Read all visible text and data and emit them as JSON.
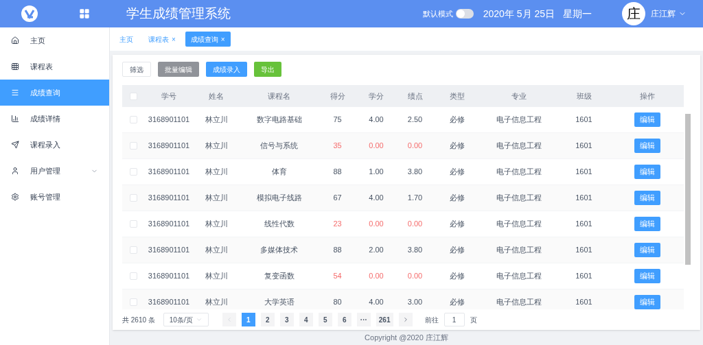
{
  "header": {
    "title": "学生成绩管理系统",
    "mode_label": "默认模式",
    "mode_switch": {
      "on": false
    },
    "date": "2020年 5月 25日",
    "weekday": "星期一",
    "avatar": "庄",
    "user": "庄江辉"
  },
  "sidebar": {
    "items": [
      {
        "label": "主页",
        "selected": false,
        "kind": "link"
      },
      {
        "label": "课程表",
        "selected": false,
        "kind": "link"
      },
      {
        "label": "成绩查询",
        "selected": true,
        "kind": "link"
      },
      {
        "label": "成绩详情",
        "selected": false,
        "kind": "link"
      },
      {
        "label": "课程录入",
        "selected": false,
        "kind": "link"
      },
      {
        "label": "用户管理",
        "selected": false,
        "kind": "group"
      },
      {
        "label": "账号管理",
        "selected": false,
        "kind": "link"
      }
    ]
  },
  "tabs": [
    {
      "label": "主页",
      "selected": false
    },
    {
      "label": "课程表",
      "selected": false,
      "close": "×"
    },
    {
      "label": "成绩查询",
      "selected": true,
      "close": "×"
    }
  ],
  "toolbar": [
    {
      "label": "筛选",
      "kind": "plain"
    },
    {
      "label": "批量编辑",
      "kind": "gray"
    },
    {
      "label": "成绩录入",
      "kind": "primary"
    },
    {
      "label": "导出",
      "kind": "success"
    }
  ],
  "table": {
    "columns": [
      "学号",
      "姓名",
      "课程名",
      "得分",
      "学分",
      "绩点",
      "类型",
      "专业",
      "班级",
      "操作"
    ],
    "header_checkbox": {
      "checked": false
    },
    "rows": [
      {
        "checked": false,
        "failed": false,
        "cells": [
          "3168901101",
          "林立川",
          "数字电路基础",
          "75",
          "4.00",
          "2.50",
          "必修",
          "电子信息工程",
          "1601"
        ],
        "action": "编辑"
      },
      {
        "checked": false,
        "failed": true,
        "cells": [
          "3168901101",
          "林立川",
          "信号与系统",
          "35",
          "0.00",
          "0.00",
          "必修",
          "电子信息工程",
          "1601"
        ],
        "action": "编辑"
      },
      {
        "checked": false,
        "failed": false,
        "cells": [
          "3168901101",
          "林立川",
          "体育",
          "88",
          "1.00",
          "3.80",
          "必修",
          "电子信息工程",
          "1601"
        ],
        "action": "编辑"
      },
      {
        "checked": false,
        "failed": false,
        "cells": [
          "3168901101",
          "林立川",
          "模拟电子线路",
          "67",
          "4.00",
          "1.70",
          "必修",
          "电子信息工程",
          "1601"
        ],
        "action": "编辑"
      },
      {
        "checked": false,
        "failed": true,
        "cells": [
          "3168901101",
          "林立川",
          "线性代数",
          "23",
          "0.00",
          "0.00",
          "必修",
          "电子信息工程",
          "1601"
        ],
        "action": "编辑"
      },
      {
        "checked": false,
        "failed": false,
        "cells": [
          "3168901101",
          "林立川",
          "多媒体技术",
          "88",
          "2.00",
          "3.80",
          "必修",
          "电子信息工程",
          "1601"
        ],
        "action": "编辑"
      },
      {
        "checked": false,
        "failed": true,
        "cells": [
          "3168901101",
          "林立川",
          "复变函数",
          "54",
          "0.00",
          "0.00",
          "必修",
          "电子信息工程",
          "1601"
        ],
        "action": "编辑"
      },
      {
        "checked": false,
        "failed": false,
        "cells": [
          "3168901101",
          "林立川",
          "大学英语",
          "80",
          "4.00",
          "3.00",
          "必修",
          "电子信息工程",
          "1601"
        ],
        "action": "编辑"
      }
    ]
  },
  "pagination": {
    "total": "共 2610 条",
    "page_size": "10条/页",
    "pages": [
      {
        "label": "1",
        "selected": true
      },
      {
        "label": "2",
        "selected": false
      },
      {
        "label": "3",
        "selected": false
      },
      {
        "label": "4",
        "selected": false
      },
      {
        "label": "5",
        "selected": false
      },
      {
        "label": "6",
        "selected": false
      },
      {
        "label": "···",
        "selected": false
      },
      {
        "label": "261",
        "selected": false
      }
    ],
    "goto_label": "前往",
    "goto_value": "1",
    "goto_unit": "页"
  },
  "footer": "Copyright @2020 庄江辉"
}
